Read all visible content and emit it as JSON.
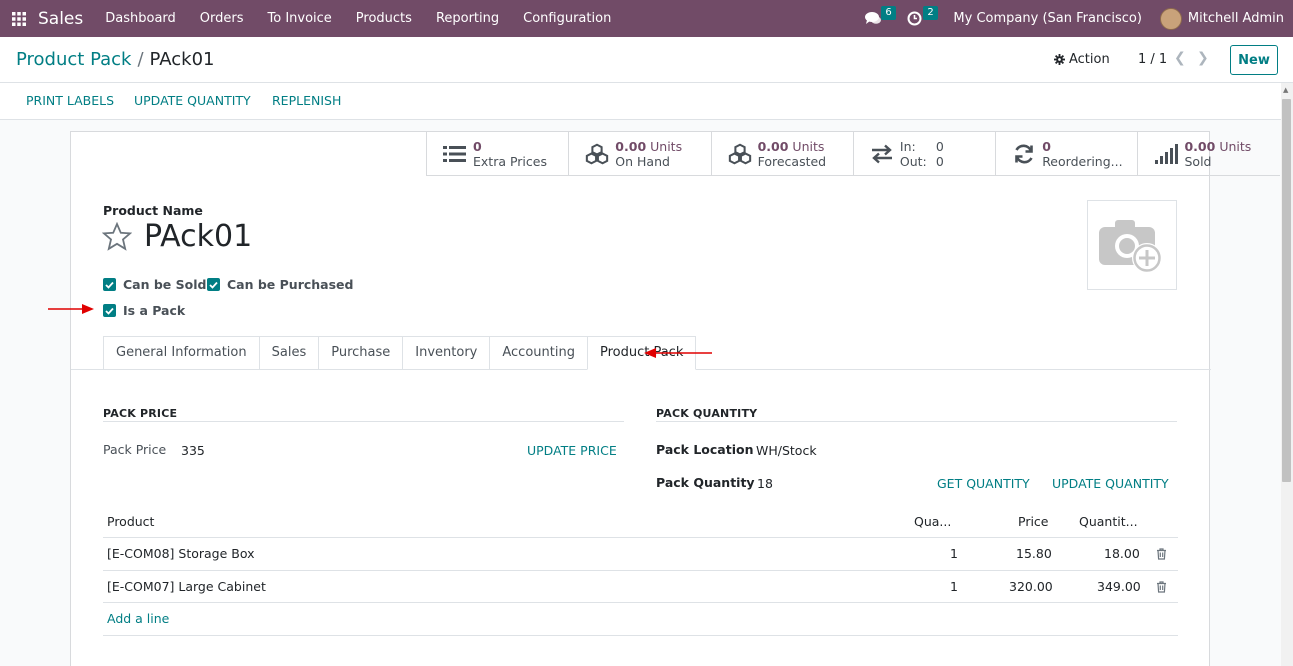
{
  "navbar": {
    "app_name": "Sales",
    "menu": [
      "Dashboard",
      "Orders",
      "To Invoice",
      "Products",
      "Reporting",
      "Configuration"
    ],
    "messages_count": "6",
    "activities_count": "2",
    "company": "My Company (San Francisco)",
    "user": "Mitchell Admin"
  },
  "control_panel": {
    "breadcrumb_parent": "Product Pack",
    "breadcrumb_sep": "/",
    "breadcrumb_current": "PAck01",
    "action_label": "Action",
    "pager": "1 / 1",
    "new_label": "New"
  },
  "statusbar": {
    "print_labels": "PRINT LABELS",
    "update_quantity": "UPDATE QUANTITY",
    "replenish": "REPLENISH"
  },
  "smart_buttons": [
    {
      "icon": "list-icon",
      "value": "0",
      "unit": "",
      "label": "Extra Prices"
    },
    {
      "icon": "cubes-icon",
      "value": "0.00",
      "unit": "Units",
      "label": "On Hand"
    },
    {
      "icon": "cubes-icon",
      "value": "0.00",
      "unit": "Units",
      "label": "Forecasted"
    },
    {
      "icon": "exchange-icon",
      "in_label": "In:",
      "in_value": "0",
      "out_label": "Out:",
      "out_value": "0"
    },
    {
      "icon": "refresh-icon",
      "value": "0",
      "unit": "",
      "label": "Reordering..."
    },
    {
      "icon": "signal-icon",
      "value": "0.00",
      "unit": "Units",
      "label": "Sold"
    }
  ],
  "form": {
    "product_name_label": "Product Name",
    "product_name": "PAck01",
    "can_be_sold": "Can be Sold",
    "can_be_purchased": "Can be Purchased",
    "is_a_pack": "Is a Pack"
  },
  "tabs": [
    "General Information",
    "Sales",
    "Purchase",
    "Inventory",
    "Accounting",
    "Product Pack"
  ],
  "active_tab": "Product Pack",
  "pack_price": {
    "title": "PACK PRICE",
    "label": "Pack Price",
    "value": "335",
    "update_price": "UPDATE PRICE"
  },
  "pack_quantity": {
    "title": "PACK QUANTITY",
    "location_label": "Pack Location",
    "location_value": "WH/Stock",
    "quantity_label": "Pack Quantity",
    "quantity_value": "18",
    "get_quantity": "GET QUANTITY",
    "update_quantity": "UPDATE QUANTITY"
  },
  "lines": {
    "headers": [
      "Product",
      "Qua...",
      "Price",
      "Quantit..."
    ],
    "rows": [
      {
        "product": "[E-COM08] Storage Box",
        "qty": "1",
        "price": "15.80",
        "quantity": "18.00"
      },
      {
        "product": "[E-COM07] Large Cabinet",
        "qty": "1",
        "price": "320.00",
        "quantity": "349.00"
      }
    ],
    "add_line": "Add a line"
  },
  "colors": {
    "brand": "#714b67",
    "accent": "#017e84",
    "arrow": "#e00000"
  }
}
